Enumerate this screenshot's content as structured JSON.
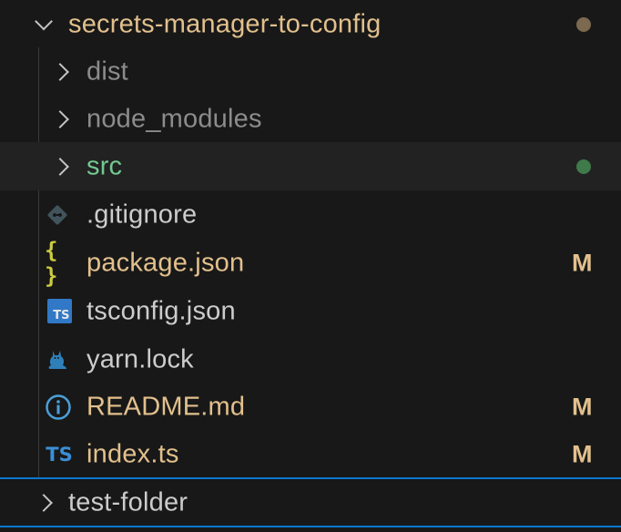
{
  "tree": {
    "root": {
      "label": "secrets-manager-to-config",
      "color": "#e2c08d",
      "dot_color": "#7c6a50"
    },
    "items": [
      {
        "label": "dist",
        "type": "folder",
        "color": "#8c8c8c"
      },
      {
        "label": "node_modules",
        "type": "folder",
        "color": "#8c8c8c"
      },
      {
        "label": "src",
        "type": "folder",
        "color": "#73c991",
        "dot_color": "#3f7a4b"
      },
      {
        "label": ".gitignore",
        "type": "file",
        "icon": "git-icon",
        "color": "#cccccc"
      },
      {
        "label": "package.json",
        "type": "file",
        "icon": "braces-icon",
        "icon_text": "{ }",
        "color": "#e2c08d",
        "badge": "M"
      },
      {
        "label": "tsconfig.json",
        "type": "file",
        "icon": "tsconfig-icon",
        "icon_text": "TS",
        "color": "#cccccc"
      },
      {
        "label": "yarn.lock",
        "type": "file",
        "icon": "yarn-cat-icon",
        "color": "#cccccc"
      },
      {
        "label": "README.md",
        "type": "file",
        "icon": "info-icon",
        "color": "#e2c08d",
        "badge": "M"
      },
      {
        "label": "index.ts",
        "type": "file",
        "icon": "typescript-icon",
        "icon_text": "TS",
        "color": "#e2c08d",
        "badge": "M"
      }
    ],
    "second_root": {
      "label": "test-folder",
      "color": "#cccccc"
    },
    "badge_color": "#e2c08d",
    "focus_color": "#0a78d0"
  }
}
